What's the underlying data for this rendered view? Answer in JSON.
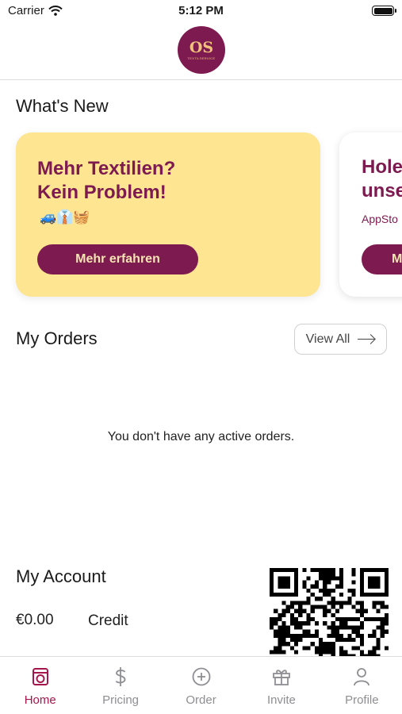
{
  "status_bar": {
    "carrier": "Carrier",
    "time": "5:12 PM"
  },
  "header": {
    "logo_main": "OS",
    "logo_sub": "TEXTILSERVICE"
  },
  "whats_new": {
    "title": "What's New",
    "cards": [
      {
        "heading_line1": "Mehr Textilien?",
        "heading_line2": "Kein Problem!",
        "emoji": "🚙👔🧺",
        "button": "Mehr erfahren"
      },
      {
        "heading_line1": "Hole",
        "heading_line2": "unse",
        "subtitle": "AppSto",
        "button": "M"
      }
    ]
  },
  "orders": {
    "title": "My Orders",
    "view_all": "View All",
    "empty_message": "You don't have any active orders."
  },
  "account": {
    "title": "My Account",
    "balance": "€0.00",
    "credit_label": "Credit"
  },
  "tabs": [
    {
      "label": "Home",
      "icon": "washing-machine-icon",
      "active": true
    },
    {
      "label": "Pricing",
      "icon": "dollar-icon",
      "active": false
    },
    {
      "label": "Order",
      "icon": "plus-circle-icon",
      "active": false
    },
    {
      "label": "Invite",
      "icon": "gift-icon",
      "active": false
    },
    {
      "label": "Profile",
      "icon": "person-icon",
      "active": false
    }
  ],
  "colors": {
    "brand": "#7d1a4f",
    "card_yellow": "#fde592",
    "active_tab": "#a3174d",
    "inactive_tab": "#8e8e93"
  }
}
